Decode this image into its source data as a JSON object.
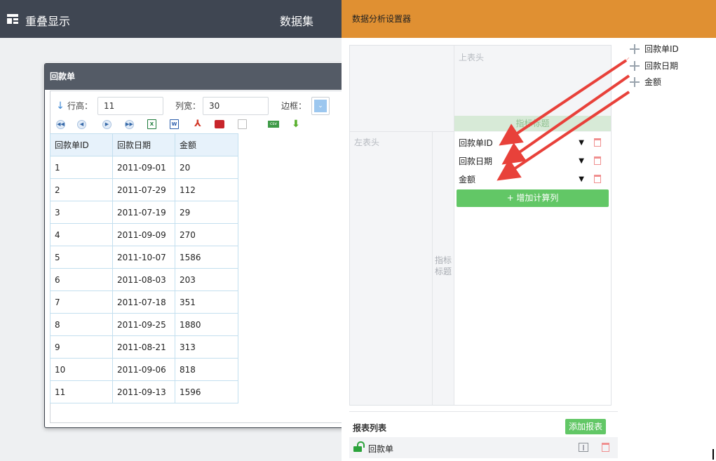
{
  "topbar": {
    "app_title": "重叠显示",
    "dataset_label": "数据集"
  },
  "window": {
    "title": "回款单",
    "toolbar": {
      "row_height_label": "行高：",
      "row_height_value": "11",
      "col_width_label": "列宽：",
      "col_width_value": "30",
      "border_label": "边框："
    },
    "iconbar": [
      "first-page-icon",
      "prev-page-icon",
      "next-page-icon",
      "last-page-icon",
      "excel-export-icon",
      "word-export-icon",
      "pdf-export-icon",
      "print-icon",
      "blank-doc-icon",
      "csv-export-icon",
      "download-arrow-icon"
    ],
    "table": {
      "columns": [
        "回款单ID",
        "回款日期",
        "金额"
      ],
      "rows": [
        [
          "1",
          "2011-09-01",
          "20"
        ],
        [
          "2",
          "2011-07-29",
          "112"
        ],
        [
          "3",
          "2011-07-19",
          "29"
        ],
        [
          "4",
          "2011-09-09",
          "270"
        ],
        [
          "5",
          "2011-10-07",
          "1586"
        ],
        [
          "6",
          "2011-08-03",
          "203"
        ],
        [
          "7",
          "2011-07-18",
          "351"
        ],
        [
          "8",
          "2011-09-25",
          "1880"
        ],
        [
          "9",
          "2011-08-21",
          "313"
        ],
        [
          "10",
          "2011-09-06",
          "818"
        ],
        [
          "11",
          "2011-09-13",
          "1596"
        ]
      ]
    }
  },
  "settings": {
    "header_title": "数据分析设置器",
    "top_header_label": "上表头",
    "left_header_label": "左表头",
    "metric_title": "指标标题",
    "left_metric_label": "指标标题",
    "measures": [
      "回款单ID",
      "回款日期",
      "金额"
    ],
    "add_calc_label": "+ 增加计算列",
    "report_list_title": "报表列表",
    "add_report_label": "添加报表",
    "report_name": "回款单"
  },
  "field_list": [
    "回款单ID",
    "回款日期",
    "金额"
  ],
  "colors": {
    "topbar": "#3f4652",
    "settings_header": "#e09032",
    "green_button": "#62c766",
    "arrow_red": "#e8413a",
    "table_border": "#c3dfef"
  }
}
